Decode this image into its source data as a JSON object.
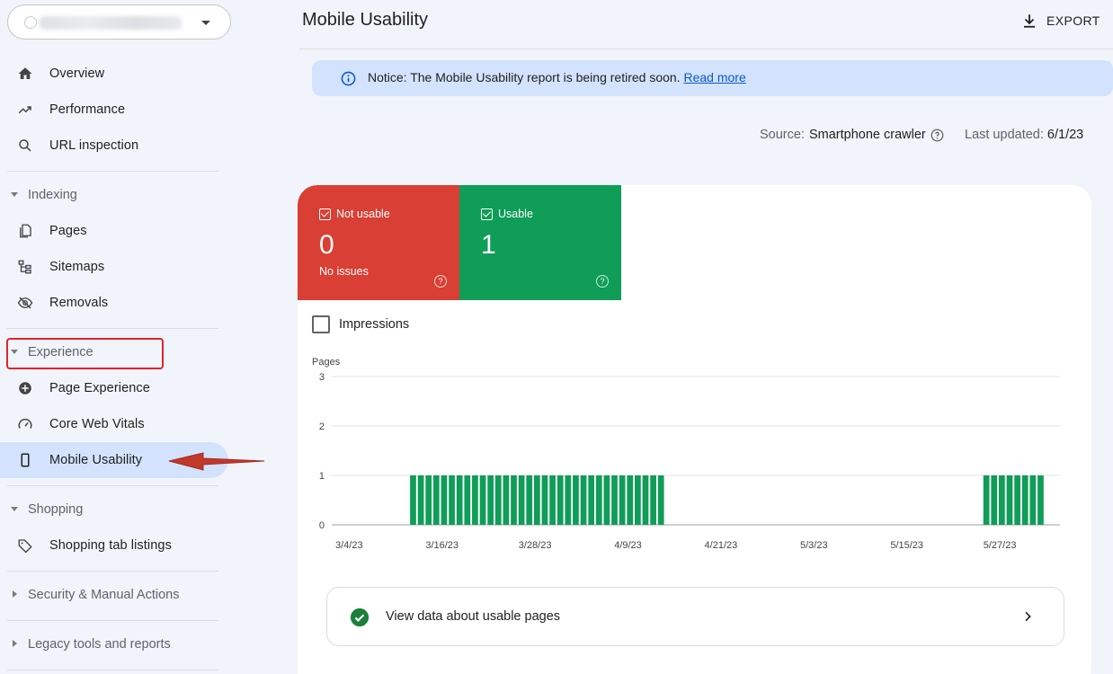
{
  "sidebar": {
    "property_icon": "globe-icon",
    "items": [
      {
        "label": "Overview",
        "icon": "home-icon"
      },
      {
        "label": "Performance",
        "icon": "trending-up-icon"
      },
      {
        "label": "URL inspection",
        "icon": "search-icon"
      },
      {
        "label": "Pages",
        "icon": "pages-icon"
      },
      {
        "label": "Sitemaps",
        "icon": "sitemap-icon"
      },
      {
        "label": "Removals",
        "icon": "eye-off-icon"
      },
      {
        "label": "Page Experience",
        "icon": "plus-circle-icon"
      },
      {
        "label": "Core Web Vitals",
        "icon": "gauge-icon"
      },
      {
        "label": "Mobile Usability",
        "icon": "smartphone-icon"
      },
      {
        "label": "Shopping tab listings",
        "icon": "tag-icon"
      }
    ],
    "sections": {
      "indexing": "Indexing",
      "experience": "Experience",
      "shopping": "Shopping",
      "security": "Security & Manual Actions",
      "legacy": "Legacy tools and reports"
    }
  },
  "header": {
    "title": "Mobile Usability",
    "export_label": "EXPORT"
  },
  "notice": {
    "text": "Notice: The Mobile Usability report is being retired soon.",
    "link": "Read more"
  },
  "meta": {
    "source_label": "Source:",
    "source_value": "Smartphone crawler",
    "updated_label": "Last updated:",
    "updated_value": "6/1/23"
  },
  "tiles": {
    "not_usable": {
      "label": "Not usable",
      "value": "0",
      "sub": "No issues",
      "color": "#d93f34"
    },
    "usable": {
      "label": "Usable",
      "value": "1",
      "color": "#0f9d58"
    }
  },
  "impressions_label": "Impressions",
  "chart_data": {
    "type": "bar",
    "ylabel": "Pages",
    "ylim": [
      0,
      3
    ],
    "yticks": [
      "0",
      "1",
      "2",
      "3"
    ],
    "xticks": [
      "3/4/23",
      "3/16/23",
      "3/28/23",
      "4/9/23",
      "4/21/23",
      "5/3/23",
      "5/15/23",
      "5/27/23"
    ],
    "start_date": "3/4/23",
    "series_color": "#0f9d58",
    "values": [
      0,
      0,
      0,
      0,
      0,
      0,
      0,
      0,
      0,
      0,
      1,
      1,
      1,
      1,
      1,
      1,
      1,
      1,
      1,
      1,
      1,
      1,
      1,
      1,
      1,
      1,
      1,
      1,
      1,
      1,
      1,
      1,
      1,
      1,
      1,
      1,
      1,
      1,
      1,
      1,
      1,
      1,
      1,
      0,
      0,
      0,
      0,
      0,
      0,
      0,
      0,
      0,
      0,
      0,
      0,
      0,
      0,
      0,
      0,
      0,
      0,
      0,
      0,
      0,
      0,
      0,
      0,
      0,
      0,
      0,
      0,
      0,
      0,
      0,
      0,
      0,
      0,
      0,
      0,
      0,
      0,
      0,
      0,
      0,
      1,
      1,
      1,
      1,
      1,
      1,
      1,
      1,
      0,
      0
    ]
  },
  "view_button": {
    "label": "View data about usable pages"
  }
}
